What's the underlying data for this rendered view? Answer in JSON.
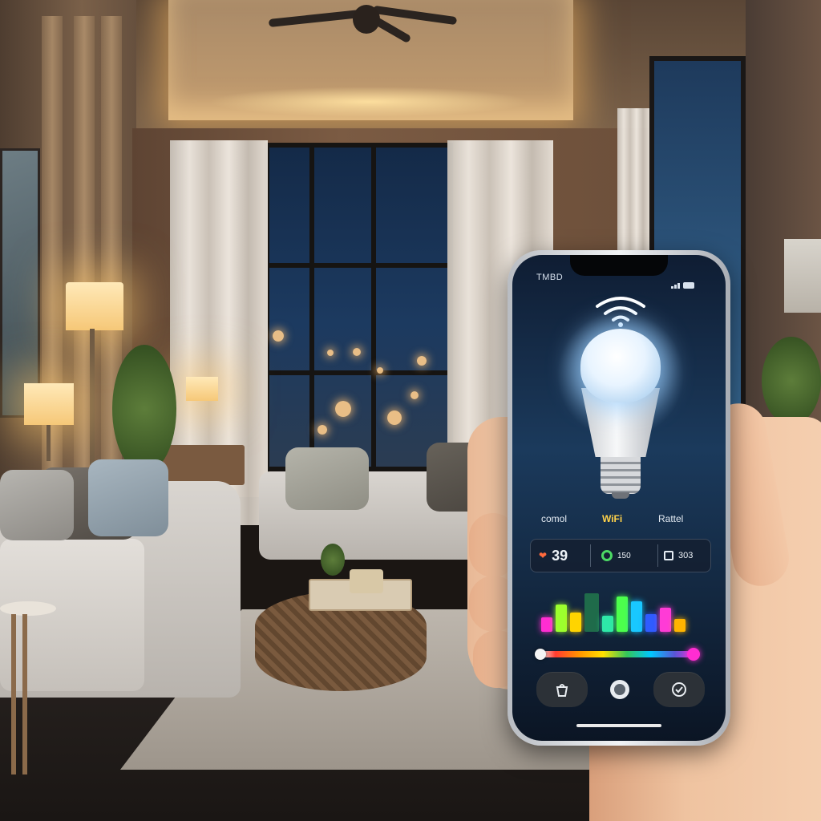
{
  "phone": {
    "status": {
      "carrier": "TMBD"
    },
    "menu": {
      "left": "comol",
      "center": "WiFi",
      "right": "Rattel"
    },
    "stats": {
      "left": "39",
      "center": "150",
      "right": "303"
    },
    "icons": {
      "wifi": "wifi-icon",
      "heart": "heart-icon",
      "power": "power-icon",
      "schedule": "calendar-icon",
      "bottom_left": "bucket-icon",
      "bottom_center": "record-icon",
      "bottom_right": "check-icon"
    },
    "colors": {
      "heart": "#ff6a3d",
      "power": "#4cd964",
      "slider_end": "#ff2dd2"
    }
  }
}
